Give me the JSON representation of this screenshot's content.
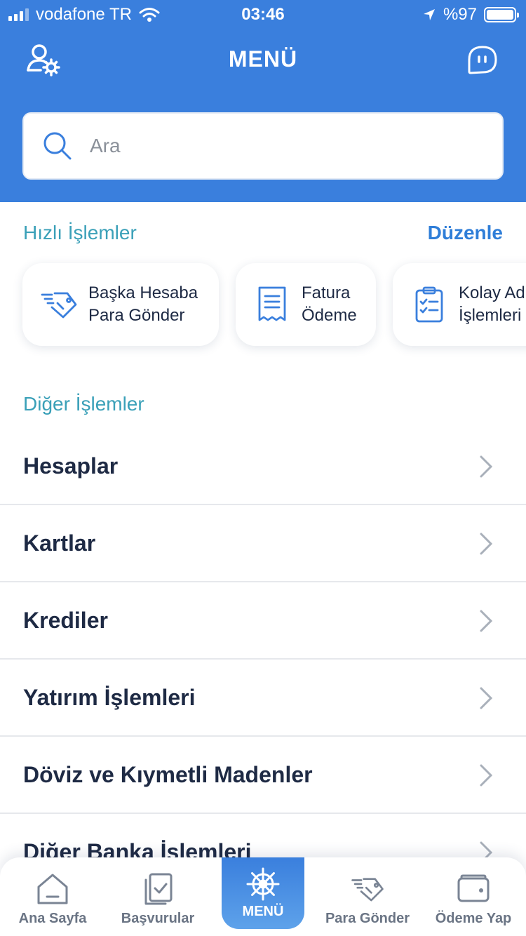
{
  "status_bar": {
    "carrier": "vodafone TR",
    "time": "03:46",
    "battery": "%97"
  },
  "header": {
    "title": "MENÜ",
    "search_placeholder": "Ara"
  },
  "quick_actions": {
    "title": "Hızlı İşlemler",
    "edit_label": "Düzenle",
    "items": [
      {
        "label": "Başka Hesaba\nPara Gönder",
        "icon": "send-money-icon"
      },
      {
        "label": "Fatura\nÖdeme",
        "icon": "invoice-icon"
      },
      {
        "label": "Kolay Ad\nİşlemleri",
        "icon": "clipboard-check-icon"
      }
    ]
  },
  "other_actions": {
    "title": "Diğer İşlemler",
    "items": [
      {
        "label": "Hesaplar"
      },
      {
        "label": "Kartlar"
      },
      {
        "label": "Krediler"
      },
      {
        "label": "Yatırım İşlemleri"
      },
      {
        "label": "Döviz ve Kıymetli Madenler"
      },
      {
        "label": "Diğer Banka İşlemleri"
      }
    ]
  },
  "tabbar": {
    "items": [
      {
        "label": "Ana Sayfa",
        "icon": "home-icon"
      },
      {
        "label": "Başvurular",
        "icon": "applications-icon"
      },
      {
        "label": "MENÜ",
        "icon": "ship-wheel-icon",
        "active": true
      },
      {
        "label": "Para Gönder",
        "icon": "send-money-icon"
      },
      {
        "label": "Ödeme Yap",
        "icon": "wallet-icon"
      }
    ]
  },
  "colors": {
    "header_blue": "#3a7fdd",
    "section_teal": "#3aa0b8",
    "link_blue": "#2f7ed8",
    "text_dark": "#1e2a44"
  }
}
